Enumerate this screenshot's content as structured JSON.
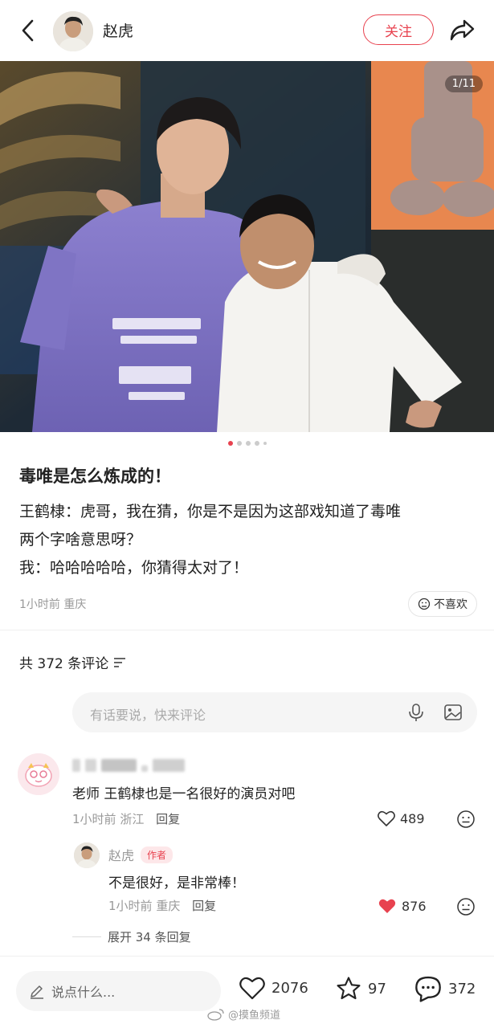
{
  "header": {
    "author_name": "赵虎",
    "follow_label": "关注"
  },
  "photo": {
    "counter": "1/11",
    "dots_total": 5,
    "active_index": 0
  },
  "post": {
    "title": "毒唯是怎么炼成的！",
    "body_line1": "王鹤棣：虎哥，我在猜，你是不是因为这部戏知道了毒唯",
    "body_line2": "两个字啥意思呀？",
    "body_line3": "我：哈哈哈哈哈，你猜得太对了！",
    "time": "1小时前",
    "location": "重庆",
    "dislike_label": "不喜欢"
  },
  "comments_section": {
    "count_label": "共 372 条评论",
    "input_placeholder": "有话要说，快来评论"
  },
  "comment1": {
    "text": "老师 王鹤棣也是一名很好的演员对吧",
    "time": "1小时前",
    "location": "浙江",
    "reply_label": "回复",
    "likes": "489"
  },
  "reply1": {
    "name": "赵虎",
    "tag": "作者",
    "text": "不是很好，是非常棒！",
    "time": "1小时前",
    "location": "重庆",
    "reply_label": "回复",
    "likes": "876"
  },
  "expand_label": "展开 34 条回复",
  "bottom_bar": {
    "say_placeholder": "说点什么...",
    "likes": "2076",
    "stars": "97",
    "comments": "372",
    "watermark": "@摸鱼频道"
  },
  "colors": {
    "accent": "#e8424f",
    "muted": "#999999"
  }
}
